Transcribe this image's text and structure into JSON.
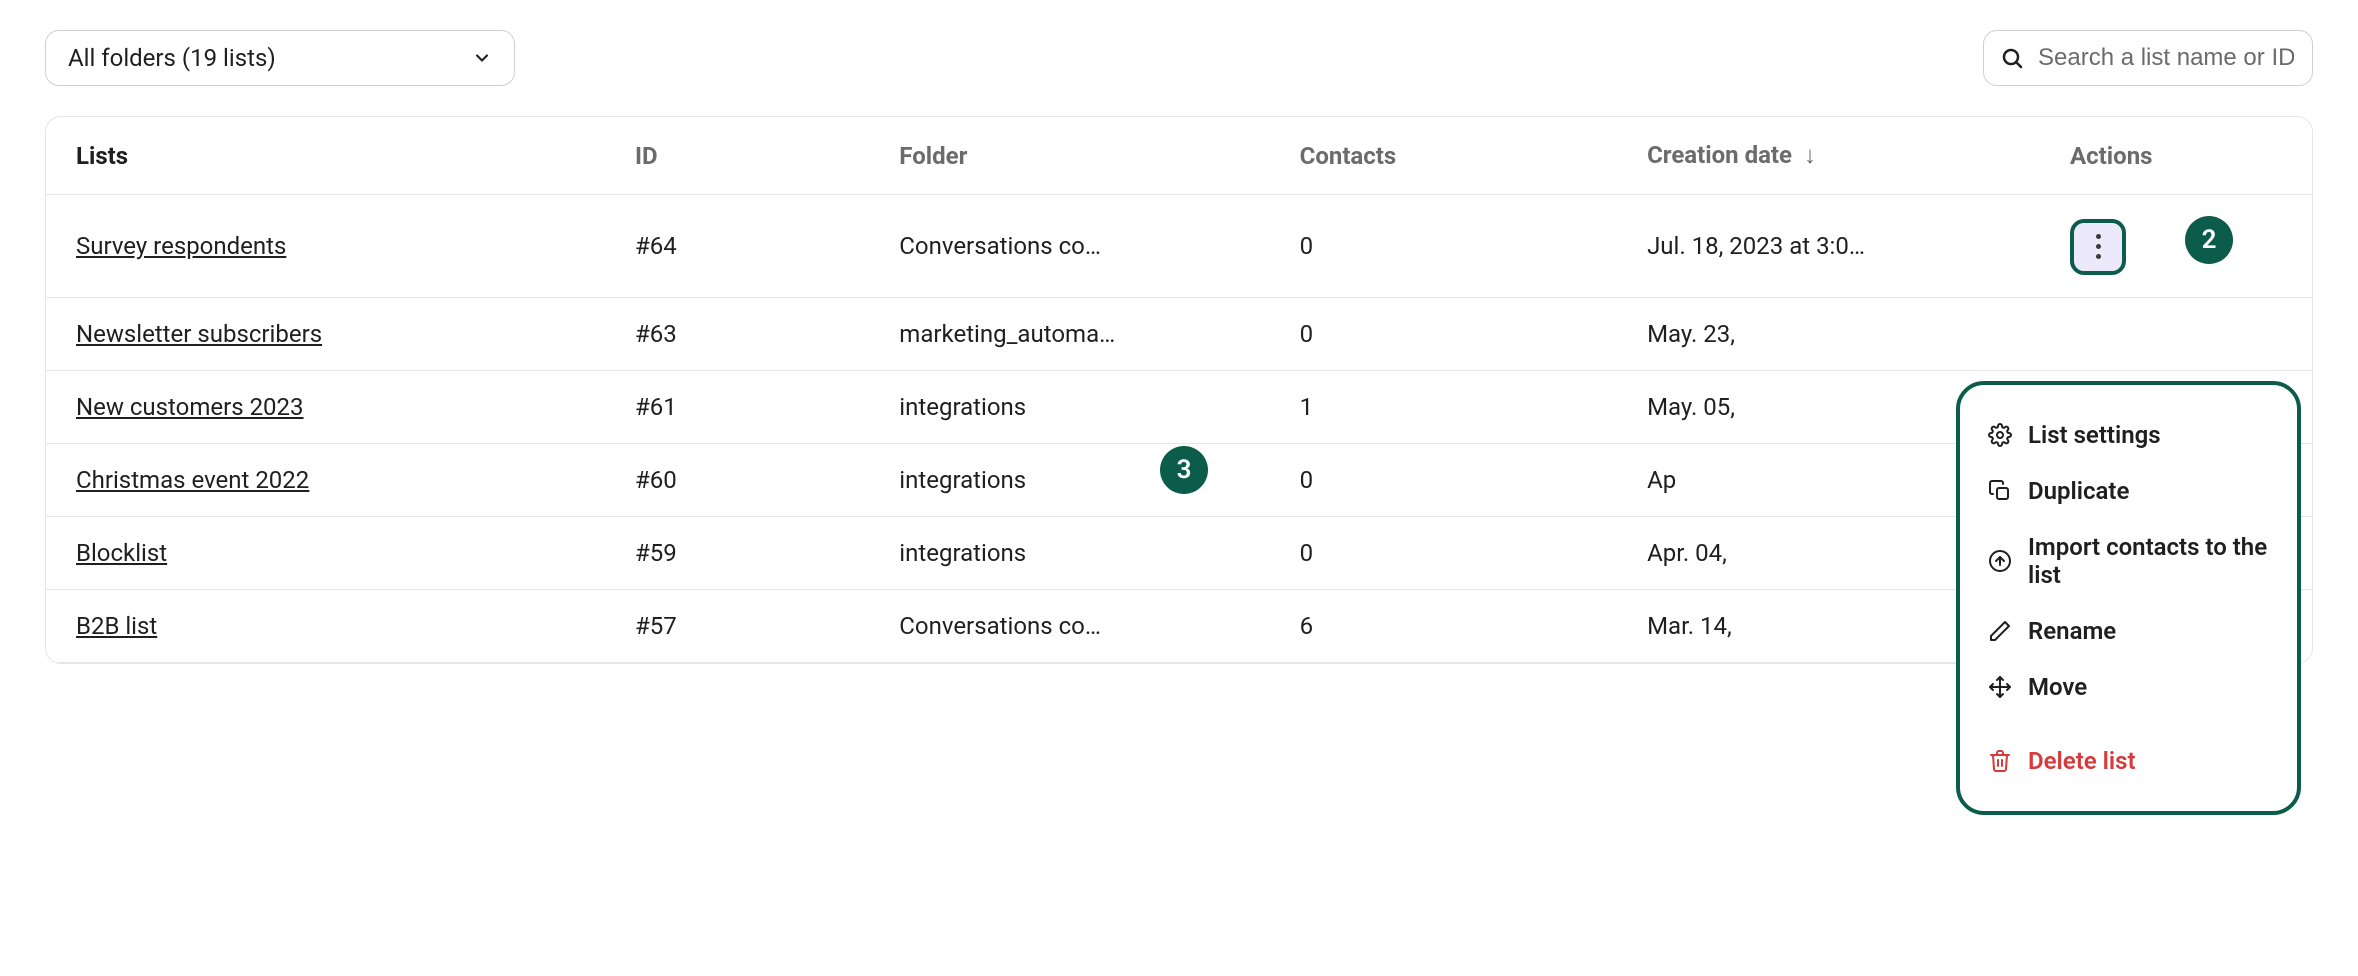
{
  "folder_select": {
    "label": "All folders (19 lists)"
  },
  "search": {
    "placeholder": "Search a list name or ID"
  },
  "columns": {
    "lists": "Lists",
    "id": "ID",
    "folder": "Folder",
    "contacts": "Contacts",
    "creation_date": "Creation date",
    "actions": "Actions"
  },
  "rows": [
    {
      "name": "Survey respondents",
      "id": "#64",
      "folder": "Conversations co…",
      "contacts": "0",
      "date": "Jul. 18, 2023 at 3:0…"
    },
    {
      "name": "Newsletter subscribers",
      "id": "#63",
      "folder": "marketing_automa…",
      "contacts": "0",
      "date": "May. 23,"
    },
    {
      "name": "New customers 2023",
      "id": "#61",
      "folder": "integrations",
      "contacts": "1",
      "date": "May. 05,"
    },
    {
      "name": "Christmas event 2022",
      "id": "#60",
      "folder": "integrations",
      "contacts": "0",
      "date": "Ap"
    },
    {
      "name": "Blocklist",
      "id": "#59",
      "folder": "integrations",
      "contacts": "0",
      "date": "Apr. 04,"
    },
    {
      "name": "B2B list",
      "id": "#57",
      "folder": "Conversations co…",
      "contacts": "6",
      "date": "Mar. 14,"
    }
  ],
  "dropdown": {
    "list_settings": "List settings",
    "duplicate": "Duplicate",
    "import": "Import contacts to the list",
    "rename": "Rename",
    "move": "Move",
    "delete": "Delete list"
  },
  "badges": {
    "two": "2",
    "three": "3"
  }
}
